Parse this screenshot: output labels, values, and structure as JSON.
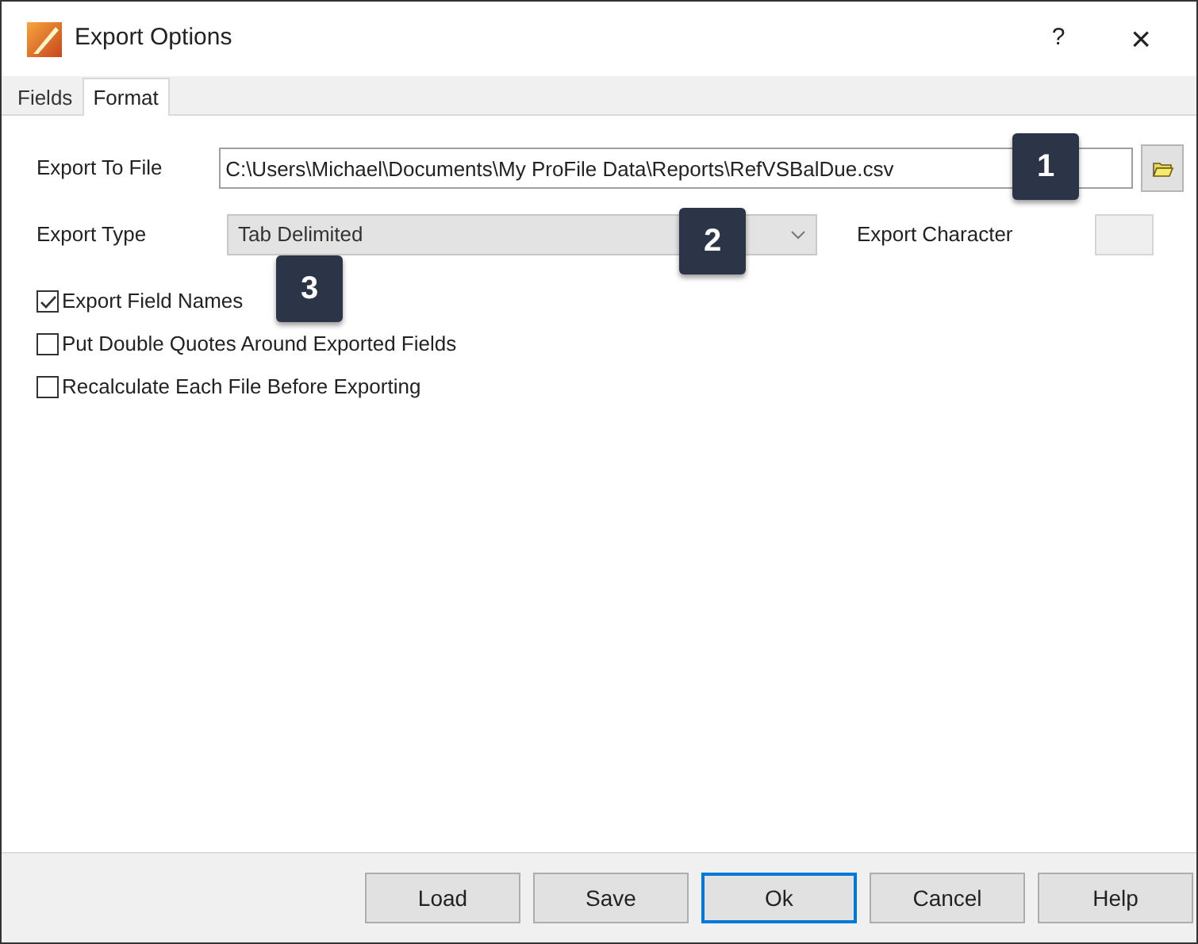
{
  "window": {
    "title": "Export Options",
    "help": "?",
    "close": "×"
  },
  "tabs": [
    {
      "label": "Fields",
      "selected": false
    },
    {
      "label": "Format",
      "selected": true
    }
  ],
  "export_to_file": {
    "label": "Export To File",
    "value": "C:\\Users\\Michael\\Documents\\My ProFile Data\\Reports\\RefVSBalDue.csv",
    "callout": "1"
  },
  "export_type": {
    "label": "Export Type",
    "value": "Tab Delimited",
    "disabled": true,
    "callout": "2"
  },
  "export_character": {
    "label": "Export Character"
  },
  "options": [
    {
      "label": "Export Field Names",
      "checked": true,
      "callout": "3"
    },
    {
      "label": "Put Double Quotes Around Exported Fields",
      "checked": false
    },
    {
      "label": "Recalculate Each File Before Exporting",
      "checked": false
    }
  ],
  "buttons": [
    {
      "label": "Load",
      "default": false
    },
    {
      "label": "Save",
      "default": false
    },
    {
      "label": "Ok",
      "default": true
    },
    {
      "label": "Cancel",
      "default": false
    },
    {
      "label": "Help",
      "default": false
    }
  ]
}
